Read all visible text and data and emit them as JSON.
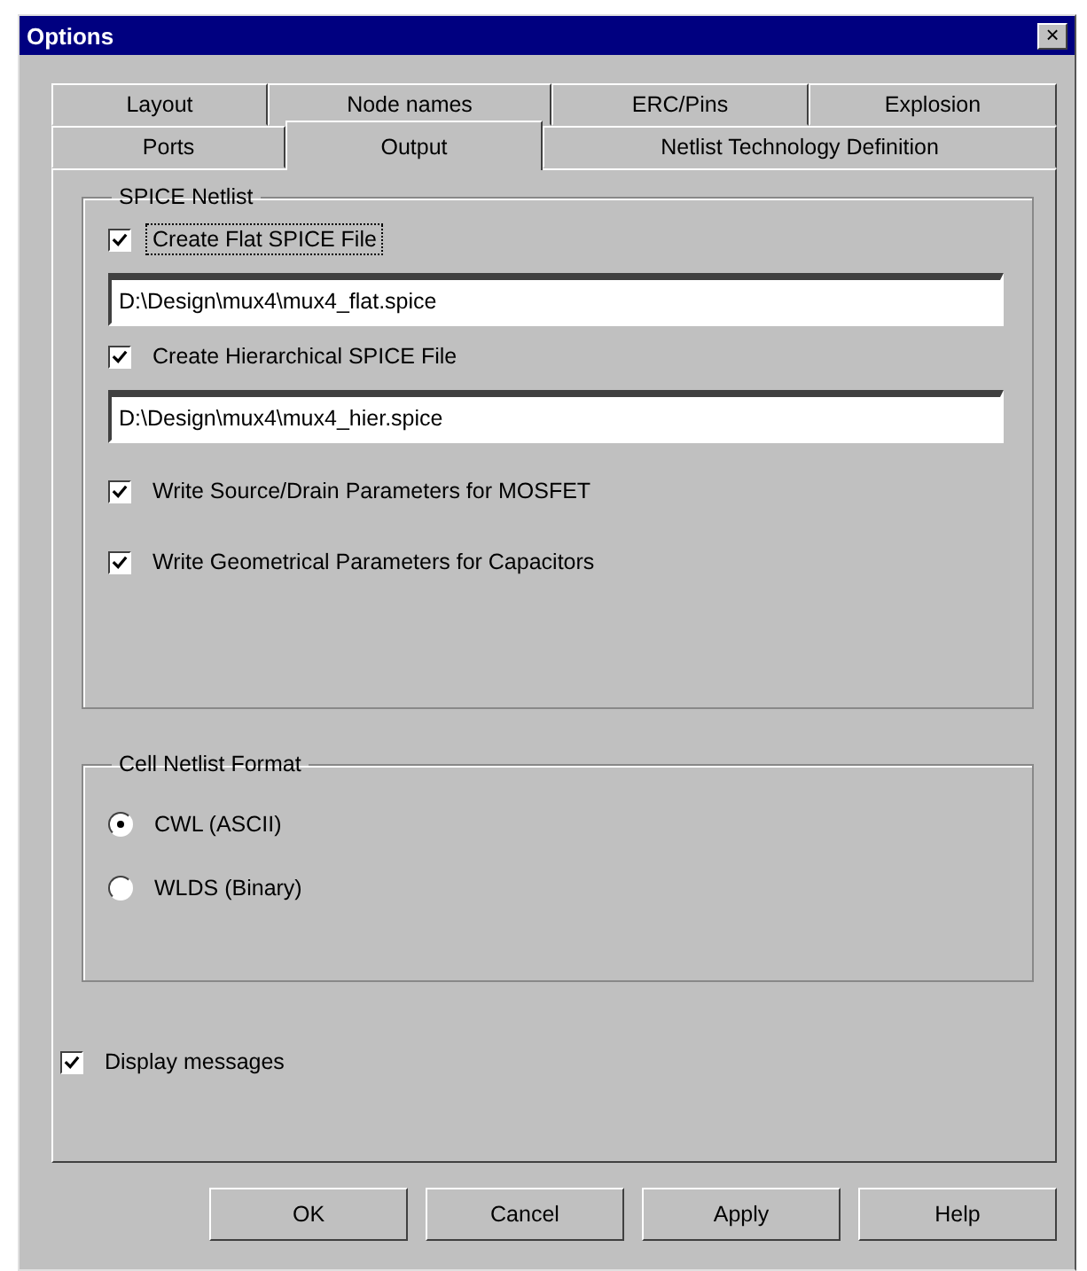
{
  "window": {
    "title": "Options",
    "close": "×"
  },
  "tab_rows": [
    [
      {
        "label": "Layout",
        "selected": false
      },
      {
        "label": "Node names",
        "selected": false
      },
      {
        "label": "ERC/Pins",
        "selected": false
      },
      {
        "label": "Explosion",
        "selected": false
      }
    ],
    [
      {
        "label": "Ports",
        "selected": false
      },
      {
        "label": "Output",
        "selected": true
      },
      {
        "label": "Netlist Technology Definition",
        "selected": false
      }
    ]
  ],
  "spice_netlist": {
    "title": "SPICE Netlist",
    "items": [
      {
        "kind": "checkbox",
        "label": "Create Flat SPICE File",
        "checked": true,
        "focused": true
      },
      {
        "kind": "field",
        "value": "D:\\Design\\mux4\\mux4_flat.spice"
      },
      {
        "kind": "checkbox",
        "label": "Create Hierarchical SPICE File",
        "checked": true,
        "focused": false
      },
      {
        "kind": "field",
        "value": "D:\\Design\\mux4\\mux4_hier.spice"
      },
      {
        "kind": "checkbox",
        "label": "Write Source/Drain Parameters for MOSFET",
        "checked": true,
        "focused": false
      },
      {
        "kind": "checkbox",
        "label": "Write Geometrical Parameters for Capacitors",
        "checked": true,
        "focused": false
      }
    ]
  },
  "cell_netlist_format": {
    "title": "Cell Netlist Format",
    "options": [
      {
        "label": "CWL (ASCII)",
        "selected": true
      },
      {
        "label": "WLDS (Binary)",
        "selected": false
      }
    ]
  },
  "display_messages": {
    "label": "Display messages",
    "checked": true
  },
  "buttons": [
    "OK",
    "Cancel",
    "Apply",
    "Help"
  ]
}
